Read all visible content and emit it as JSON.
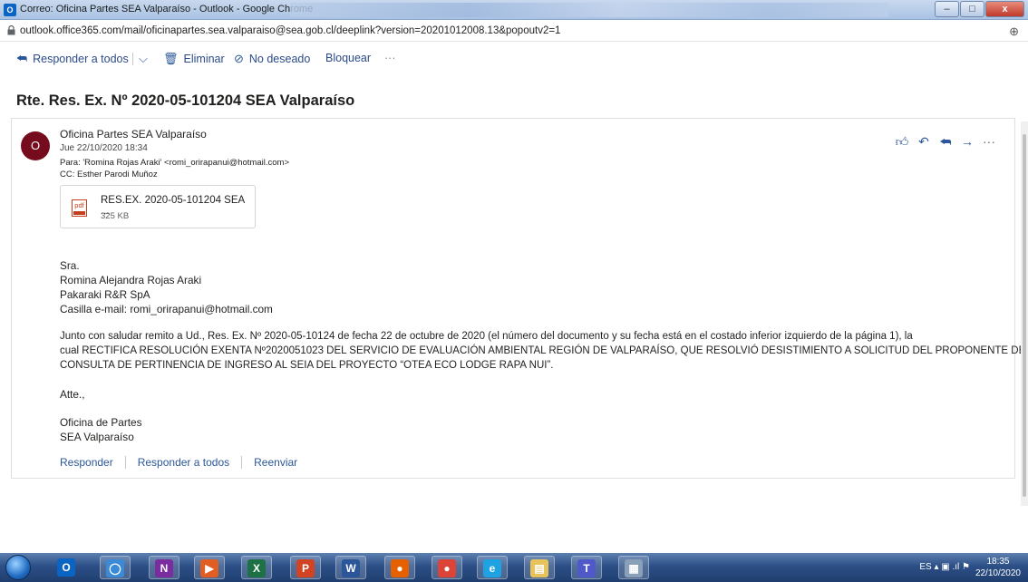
{
  "window": {
    "title": "Correo: Oficina Partes SEA Valparaíso - Outlook - Google Chrome",
    "app_icon_letter": "O",
    "minimize": "–",
    "maximize": "□",
    "close": "x"
  },
  "urlbar": {
    "url": "outlook.office365.com/mail/oficinapartes.sea.valparaiso@sea.gob.cl/deeplink?version=20201012008.13&popoutv2=1",
    "zoom_icon": "⊕"
  },
  "toolbar": {
    "reply_all": "Responder a todos",
    "delete": "Eliminar",
    "junk": "No deseado",
    "block": "Bloquear",
    "more": "···"
  },
  "message": {
    "subject": "Rte. Res. Ex. Nº 2020-05-101204 SEA Valparaíso",
    "avatar_letter": "O",
    "avatar_color": "#750b1c",
    "sender": "Oficina Partes SEA Valparaíso",
    "date": "Jue 22/10/2020 18:34",
    "to": "Para: 'Romina Rojas Araki' <romi_orirapanui@hotmail.com>",
    "cc": "CC: Esther Parodi Muñoz",
    "attachment": {
      "name": "RES.EX. 2020-05-101204 SEA ...",
      "size": "325 KB",
      "type_label": "pdf"
    },
    "body": {
      "greeting": "Sra.",
      "name": "Romina Alejandra Rojas Araki",
      "company": "Pakaraki R&R SpA",
      "email": "Casilla e-mail: romi_orirapanui@hotmail.com",
      "para1_line1": "Junto con saludar remito a Ud., Res. Ex. Nº 2020-05-10124 de fecha 22 de octubre de 2020 (el número del documento y su fecha está en el costado inferior izquierdo de la página 1), la",
      "para1_line2": "cual RECTIFICA RESOLUCIÓN EXENTA Nº2020051023 DEL SERVICIO DE EVALUACIÓN AMBIENTAL REGIÓN DE VALPARAÍSO, QUE RESOLVIÓ DESISTIMIENTO A SOLICITUD DEL PROPONENTE DE",
      "para1_line3": "CONSULTA DE PERTINENCIA DE INGRESO AL SEIA DEL PROYECTO “OTEA ECO LODGE RAPA NUI”.",
      "closing": "Atte.,",
      "sig1": "Oficina de Partes",
      "sig2": "SEA Valparaíso"
    },
    "reply_links": {
      "reply": "Responder",
      "reply_all": "Responder a todos",
      "forward": "Reenviar"
    }
  },
  "taskbar": {
    "apps": [
      {
        "name": "outlook",
        "letter": "O",
        "color": "#0a64c4"
      },
      {
        "name": "generic-app",
        "letter": "◯",
        "color": "#3b8ad8"
      },
      {
        "name": "onenote",
        "letter": "N",
        "color": "#7b2c9e"
      },
      {
        "name": "media-app",
        "letter": "▶",
        "color": "#e25d22"
      },
      {
        "name": "excel",
        "letter": "X",
        "color": "#1e7145"
      },
      {
        "name": "powerpoint",
        "letter": "P",
        "color": "#d04423"
      },
      {
        "name": "word",
        "letter": "W",
        "color": "#2b579a"
      },
      {
        "name": "firefox",
        "letter": "●",
        "color": "#e66000"
      },
      {
        "name": "chrome",
        "letter": "●",
        "color": "#db4437"
      },
      {
        "name": "internet-explorer",
        "letter": "e",
        "color": "#1ea2e1"
      },
      {
        "name": "file-explorer",
        "letter": "▤",
        "color": "#e8c25a"
      },
      {
        "name": "teams",
        "letter": "T",
        "color": "#5059c9"
      },
      {
        "name": "calculator",
        "letter": "▦",
        "color": "#8aa0b8"
      }
    ],
    "tray": "ES  ▴  ▣  .ıl  ⚑",
    "time": "18:35",
    "date": "22/10/2020"
  }
}
